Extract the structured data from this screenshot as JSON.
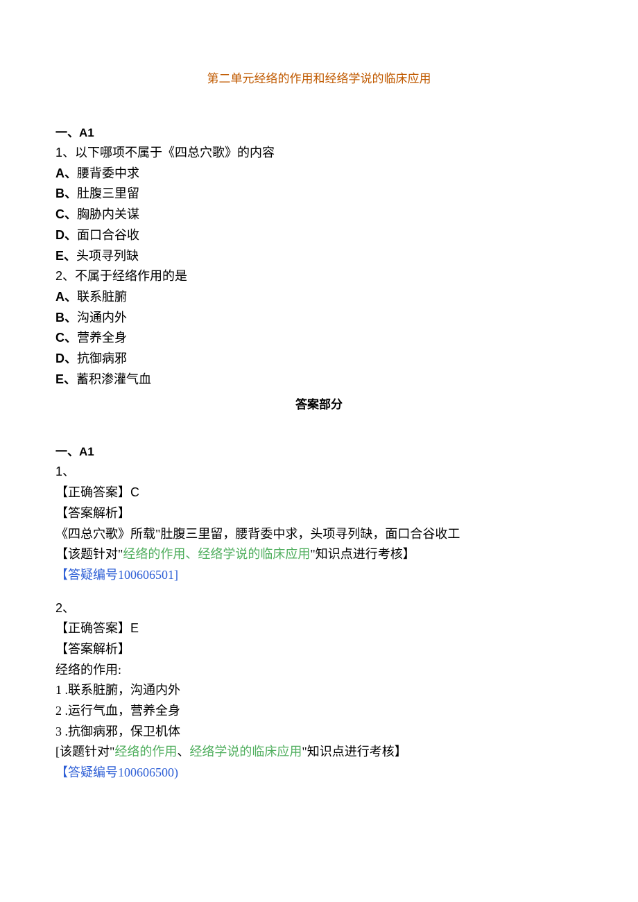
{
  "title": "第二单元经络的作用和经络学说的临床应用",
  "sec1": {
    "label_prefix": "一、",
    "label_a1": "A1"
  },
  "q1": {
    "num": "1、",
    "stem": "以下哪项不属于《四总穴歌》的内容",
    "A": {
      "l": "A、",
      "t": "腰背委中求"
    },
    "B": {
      "l": "B、",
      "t": "肚腹三里留"
    },
    "C": {
      "l": "C、",
      "t": "胸胁内关谋"
    },
    "D": {
      "l": "D、",
      "t": "面口合谷收"
    },
    "E": {
      "l": "E、",
      "t": "头项寻列缺"
    }
  },
  "q2": {
    "num": "2、",
    "stem": "不属于经络作用的是",
    "A": {
      "l": "A、",
      "t": "联系脏腑"
    },
    "B": {
      "l": "B、",
      "t": "沟通内外"
    },
    "C": {
      "l": "C、",
      "t": "营养全身"
    },
    "D": {
      "l": "D、",
      "t": "抗御病邪"
    },
    "E": {
      "l": "E、",
      "t": "蓄积渗灌气血"
    }
  },
  "ans_header": "答案部分",
  "sec2": {
    "label_prefix": "一、",
    "label_a1": "A1"
  },
  "a1": {
    "num": "1、",
    "correct_label": "【正确答案】",
    "correct_val": "C",
    "explain_label": "【答案解析】",
    "explain_text": "《四总穴歌》所载\"肚腹三里留，腰背委中求，头项寻列缺，面口合谷收工",
    "point_pre": "【该题针对\"",
    "point_green": "经络的作用、经络学说的临床应用",
    "point_post": "\"知识点进行考核】",
    "ref_pre": "【",
    "ref_mid": "答疑编号100606501]"
  },
  "a2": {
    "num": "2、",
    "correct_label": "【正确答案】",
    "correct_val": "E",
    "explain_label": "【答案解析】",
    "explain_lines": {
      "l0": "经络的作用:",
      "l1": "1 .联系脏腑，沟通内外",
      "l2": "2 .运行气血，营养全身",
      "l3": "3 .抗御病邪，保卫机体"
    },
    "point_pre": "[该题针对\"",
    "point_green1": "经络的作用",
    "point_mid": "、",
    "point_green2": "经络学说的临床应用",
    "point_post": "\"知识点进行考核】",
    "ref_pre": "【",
    "ref_mid": "答疑编号100606500)"
  }
}
